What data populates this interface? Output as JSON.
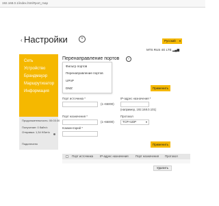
{
  "browser": {
    "url": "192.168.0.1/index.html#port_map"
  },
  "page": {
    "title": "Настройки"
  },
  "header": {
    "language": "Русский",
    "network_status": "MTS RUS 4G LTE"
  },
  "sidebar": {
    "items": [
      {
        "label": "Сеть"
      },
      {
        "label": "Устройство"
      },
      {
        "label": "Брандмауэр"
      },
      {
        "label": "Маршрутизатор"
      },
      {
        "label": "Информация"
      }
    ],
    "stats": {
      "duration": "Продолжительность: 00:03:30",
      "received": "Получение: 0 байт/с",
      "sent": "Отправка: 1,34 Kбит/с",
      "connection": "Подключено"
    }
  },
  "main": {
    "section_title": "Перенаправление портов",
    "dropdown": [
      {
        "label": "Фильтр портов"
      },
      {
        "label": "Перенаправление портов"
      },
      {
        "label": "UPnP"
      },
      {
        "label": "DMZ"
      }
    ],
    "apply_label": "Применить",
    "form": {
      "source_port_label": "Порт источника *",
      "source_port_range": "(1~65000)",
      "ip_label": "IP-адрес назначения *",
      "ip_hint": "(например, 192.168.0.101)",
      "dest_port_label": "Порт назначения *",
      "dest_port_range": "(1~65000)",
      "protocol_label": "Протокол",
      "protocol_value": "TCP+UDP",
      "comment_label": "Комментарий *",
      "add_label": "Применить"
    },
    "table": {
      "headers": [
        "Порт источника",
        "IP-адрес назначения",
        "Порт назначения",
        "Протокол"
      ]
    },
    "delete_label": "Удалить"
  }
}
